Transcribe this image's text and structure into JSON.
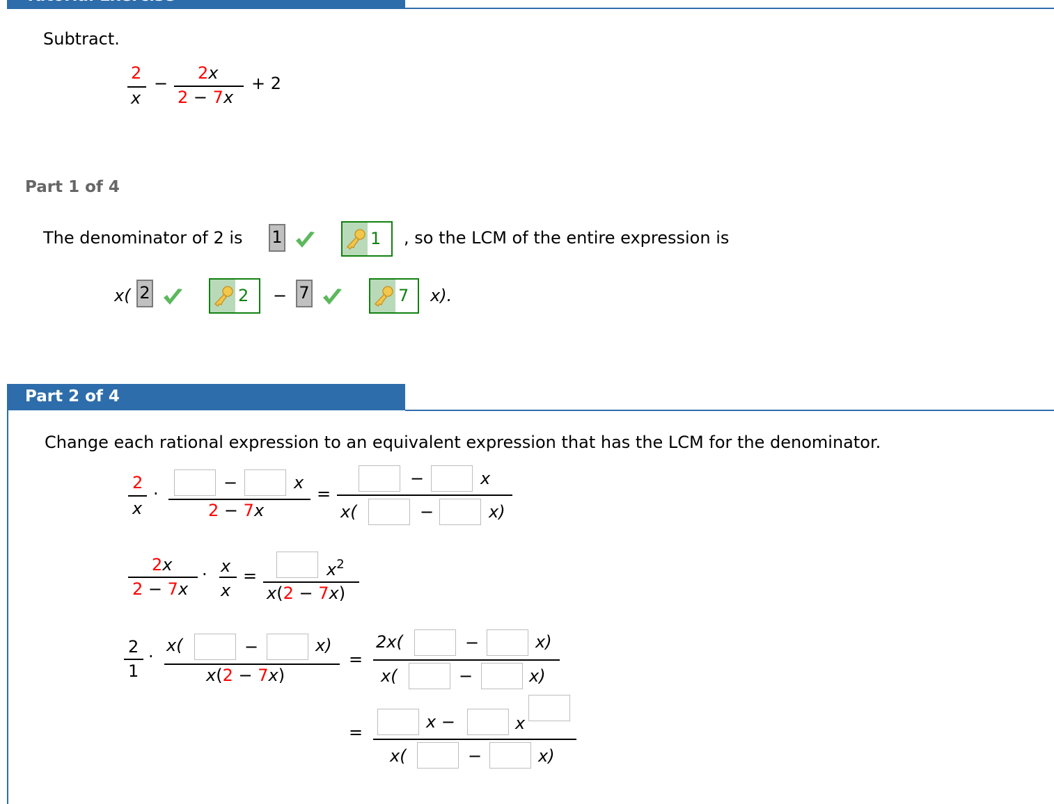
{
  "header": {
    "title": "Tutorial Exercise"
  },
  "problem": {
    "instruction": "Subtract.",
    "expr": {
      "f1_num": "2",
      "f1_den": "x",
      "minus": "−",
      "f2_num_coef": "2",
      "f2_num_var": "x",
      "f2_den_a": "2",
      "f2_den_op": " − ",
      "f2_den_b": "7",
      "f2_den_var": "x",
      "plus": "+ 2"
    }
  },
  "part1": {
    "title": "Part 1 of 4",
    "sentence_start": "The denominator of 2 is",
    "answer_1": "1",
    "key_1": "1",
    "sentence_end": ", so the LCM of the entire expression is",
    "lcm_prefix": "x(",
    "answer_2": "2",
    "key_2": "2",
    "minus": "−",
    "answer_3": "7",
    "key_3": "7",
    "lcm_suffix": "x).",
    "status": "correct"
  },
  "part2": {
    "title": "Part 2 of 4",
    "instruction": "Change each rational expression to an equivalent expression that has the LCM for the denominator.",
    "sym": {
      "minus": "−",
      "eq": "=",
      "dot": "·",
      "x": "x",
      "xopen": "x(",
      "xclose": "x)",
      "two": "2",
      "seven": "7",
      "one": "1",
      "op": " − ",
      "open": "(",
      "close": ")",
      "twox_open": "2x(",
      "x_minus": "x −",
      "sq": "2"
    },
    "inputs": {
      "values": [
        "",
        "",
        "",
        "",
        "",
        "",
        "",
        "",
        "",
        "",
        "",
        "",
        "",
        "",
        "",
        "",
        "",
        "",
        "",
        "",
        ""
      ]
    }
  },
  "colors": {
    "accent": "#2e6dab",
    "highlight": "#ff0000",
    "correct": "#118011"
  },
  "icons": {
    "check": "checkmark-icon",
    "key": "key-icon"
  }
}
